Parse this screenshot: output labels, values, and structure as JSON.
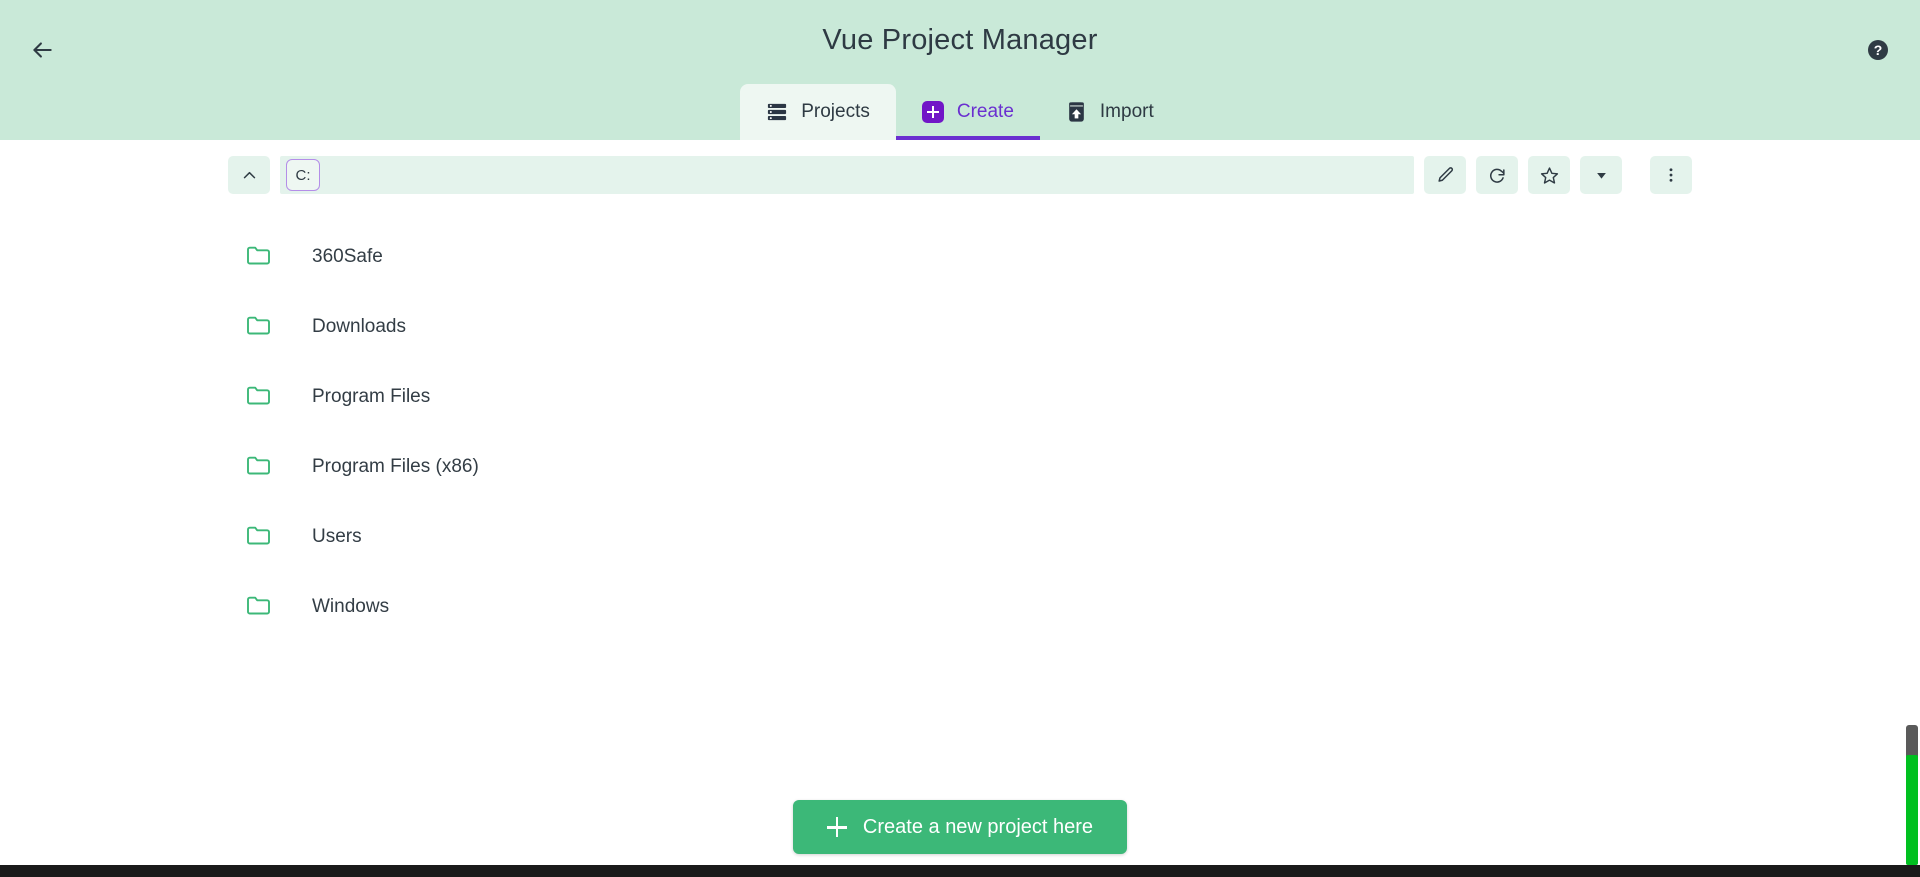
{
  "header": {
    "title": "Vue Project Manager",
    "back_icon": "arrow-left-icon",
    "help_icon": "help-circle-icon",
    "background_color": "#c9e9d8"
  },
  "tabs": [
    {
      "label": "Projects",
      "icon": "list-rows-icon",
      "active_surface": true,
      "underline": false,
      "accent": "#2e3a43"
    },
    {
      "label": "Create",
      "icon": "plus-square-icon",
      "active_surface": false,
      "underline": true,
      "accent": "#6a2fd0"
    },
    {
      "label": "Import",
      "icon": "upload-box-icon",
      "active_surface": false,
      "underline": false,
      "accent": "#2e3a43"
    }
  ],
  "toolbar": {
    "up_icon": "chevron-up-icon",
    "breadcrumbs": [
      {
        "label": "C:",
        "selected": true
      }
    ],
    "actions": [
      {
        "name": "edit-path-button",
        "icon": "pencil-icon"
      },
      {
        "name": "refresh-button",
        "icon": "refresh-icon"
      },
      {
        "name": "favorite-button",
        "icon": "star-icon"
      },
      {
        "name": "favorites-dropdown-button",
        "icon": "chevron-down-icon"
      },
      {
        "name": "more-options-button",
        "icon": "kebab-menu-icon"
      }
    ]
  },
  "file_list": {
    "items": [
      {
        "name": "360Safe",
        "icon": "folder-icon"
      },
      {
        "name": "Downloads",
        "icon": "folder-icon"
      },
      {
        "name": "Program Files",
        "icon": "folder-icon"
      },
      {
        "name": "Program Files (x86)",
        "icon": "folder-icon"
      },
      {
        "name": "Users",
        "icon": "folder-icon"
      },
      {
        "name": "Windows",
        "icon": "folder-icon"
      }
    ]
  },
  "footer": {
    "create_button_label": "Create a new project here",
    "create_button_icon": "plus-icon",
    "create_button_color": "#3cb878"
  },
  "colors": {
    "header_bg": "#c9e9d8",
    "toolbar_field": "#e4f3ec",
    "purple_accent": "#6a2fd0",
    "green_accent": "#3cb878",
    "folder_green": "#3cb878",
    "text_dark": "#2e3a43"
  }
}
